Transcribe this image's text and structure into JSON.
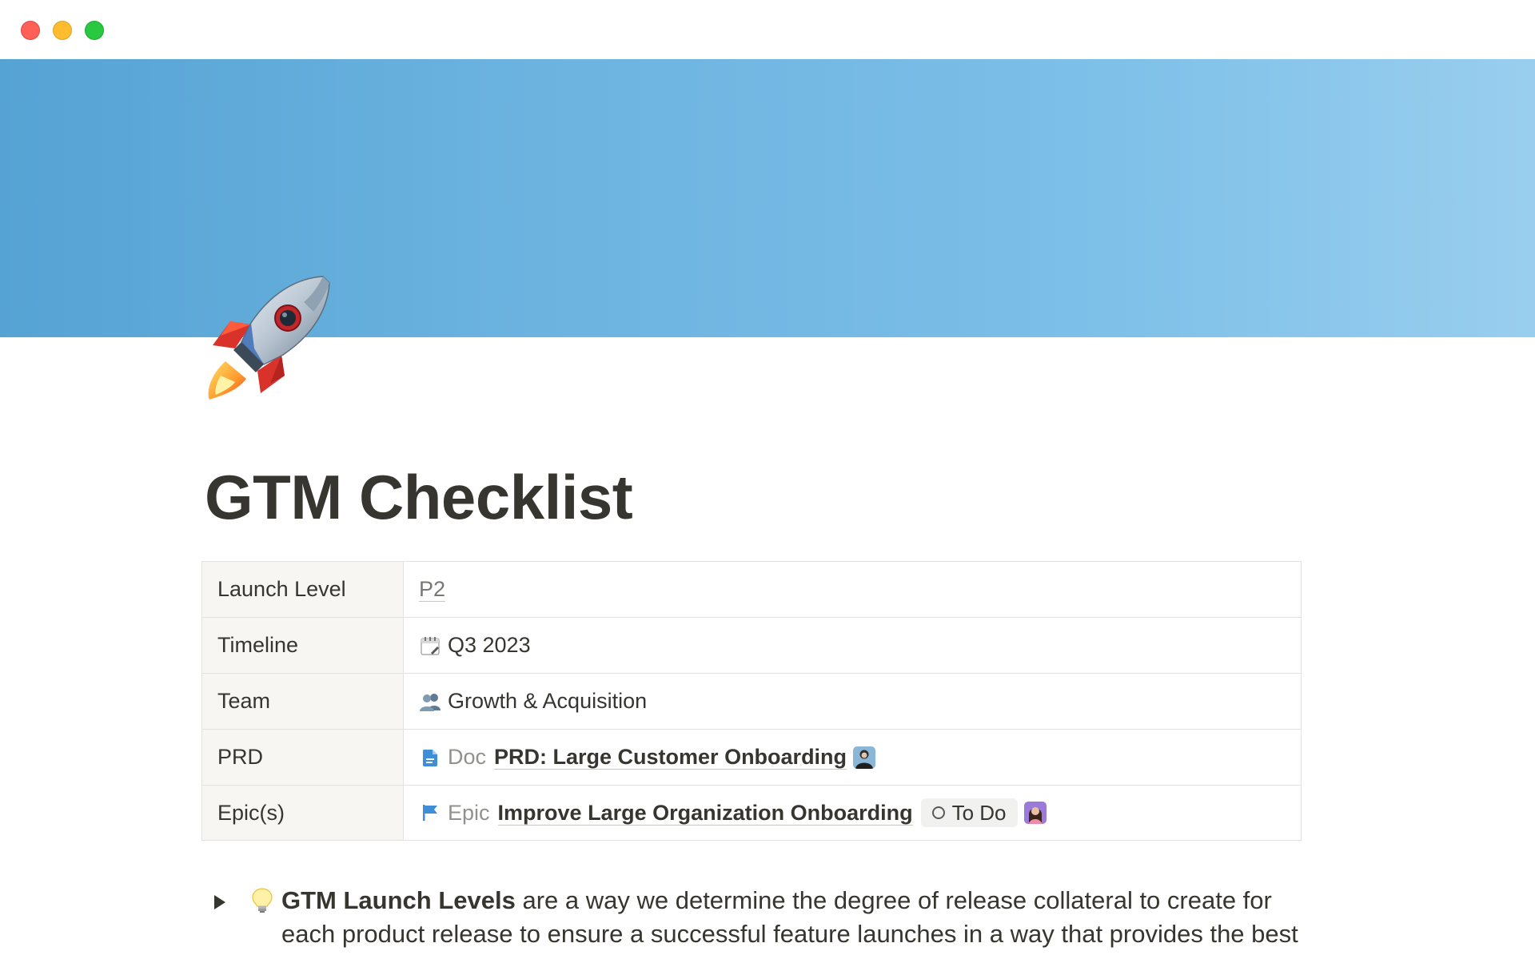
{
  "window": {
    "controls": [
      "close",
      "minimize",
      "maximize"
    ]
  },
  "page": {
    "icon": "rocket-icon",
    "title": "GTM Checklist"
  },
  "properties": [
    {
      "name": "Launch Level",
      "value": "P2"
    },
    {
      "name": "Timeline",
      "icon": "calendar-icon",
      "value": "Q3 2023"
    },
    {
      "name": "Team",
      "icon": "people-icon",
      "value": "Growth & Acquisition"
    },
    {
      "name": "PRD",
      "icon": "doc-icon",
      "type_label": "Doc",
      "value": "PRD: Large Customer Onboarding",
      "avatar": "owner-avatar"
    },
    {
      "name": "Epic(s)",
      "icon": "flag-icon",
      "type_label": "Epic",
      "value": "Improve Large Organization Onboarding",
      "status": "To Do",
      "avatar": "assignee-avatar"
    }
  ],
  "toggle": {
    "icon": "lightbulb-icon",
    "bold_text": "GTM Launch Levels",
    "text": " are a way we determine the degree of release collateral to create for each product release to ensure a successful feature launches in a way that provides the best"
  },
  "colors": {
    "cover_start": "#55a3d4",
    "cover_end": "#99ceee",
    "text": "#37352f",
    "muted": "#91918e",
    "property_bg": "#f7f6f3"
  }
}
